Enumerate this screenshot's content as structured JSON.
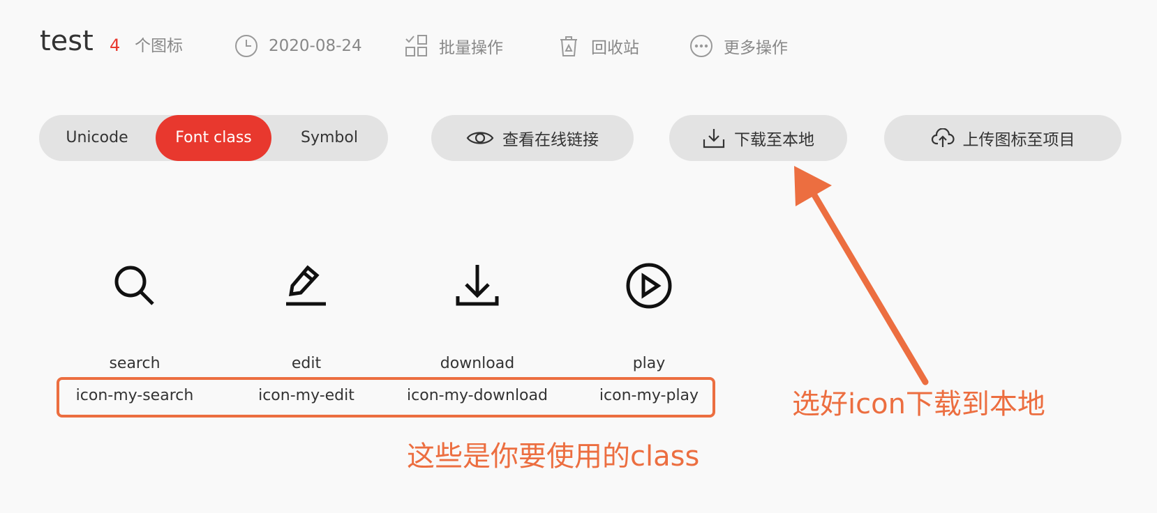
{
  "header": {
    "title": "test",
    "icon_count": "4",
    "icon_count_label": "个图标",
    "date": "2020-08-24",
    "batch_label": "批量操作",
    "recycle_label": "回收站",
    "more_label": "更多操作"
  },
  "tabs": [
    {
      "label": "Unicode",
      "active": false
    },
    {
      "label": "Font class",
      "active": true
    },
    {
      "label": "Symbol",
      "active": false
    }
  ],
  "actions": {
    "view_link_label": "查看在线链接",
    "download_label": "下载至本地",
    "upload_label": "上传图标至项目"
  },
  "icons": [
    {
      "name": "search",
      "class": "icon-my-search",
      "icon": "search-icon"
    },
    {
      "name": "edit",
      "class": "icon-my-edit",
      "icon": "edit-icon"
    },
    {
      "name": "download",
      "class": "icon-my-download",
      "icon": "download-icon"
    },
    {
      "name": "play",
      "class": "icon-my-play",
      "icon": "play-icon"
    }
  ],
  "annotations": {
    "download_hint": "选好icon下载到本地",
    "class_hint": "这些是你要使用的class"
  },
  "colors": {
    "accent": "#e8382e",
    "annotation": "#ec6e40",
    "pill_bg": "#e3e3e3",
    "muted_text": "#888888"
  }
}
